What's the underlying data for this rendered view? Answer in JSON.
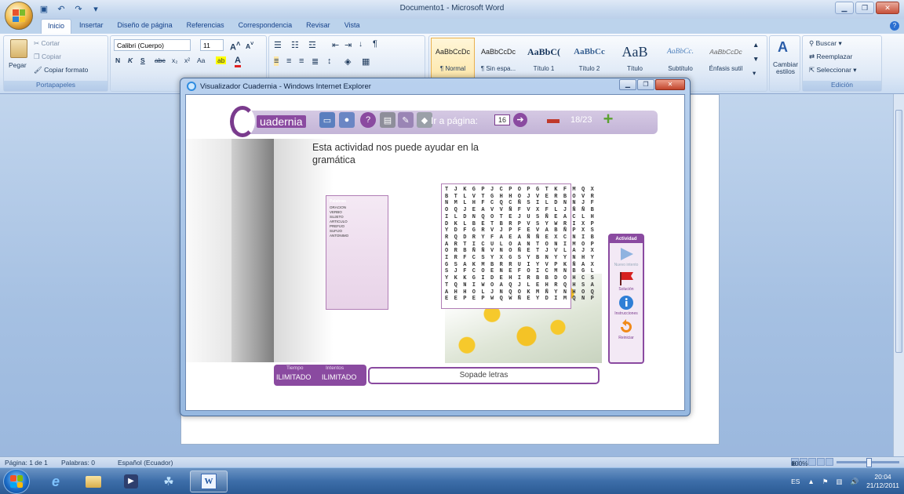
{
  "window": {
    "title": "Documento1 - Microsoft Word"
  },
  "tabs": [
    "Inicio",
    "Insertar",
    "Diseño de página",
    "Referencias",
    "Correspondencia",
    "Revisar",
    "Vista"
  ],
  "ribbon": {
    "clipboard": {
      "pegar": "Pegar",
      "cortar": "Cortar",
      "copiar": "Copiar",
      "copiar_formato": "Copiar formato",
      "label": "Portapapeles"
    },
    "font": {
      "name": "Calibri (Cuerpo)",
      "size": "11"
    },
    "styles": [
      {
        "preview": "AaBbCcDc",
        "name": "¶ Normal"
      },
      {
        "preview": "AaBbCcDc",
        "name": "¶ Sin espa..."
      },
      {
        "preview": "AaBbC(",
        "name": "Título 1"
      },
      {
        "preview": "AaBbCc",
        "name": "Título 2"
      },
      {
        "preview": "AaB",
        "name": "Título"
      },
      {
        "preview": "AaBbCc.",
        "name": "Subtítulo"
      },
      {
        "preview": "AaBbCcDc",
        "name": "Énfasis sutil"
      }
    ],
    "cambiar_estilos": "Cambiar estilos",
    "edicion": {
      "buscar": "Buscar",
      "reemplazar": "Reemplazar",
      "seleccionar": "Seleccionar",
      "label": "Edición"
    }
  },
  "ie": {
    "title": "Visualizador Cuadernia - Windows Internet Explorer",
    "cuadernia": {
      "logo_text": "uadernia",
      "goto_label": "Ir a página:",
      "goto_value": "16",
      "page_count": "18/23",
      "activity_text": "Esta actividad nos puede ayudar en la gramática",
      "words_title": "Palabras",
      "words": [
        "ORACION",
        "VERBO",
        "SUJETO",
        "ARTICULO",
        "PREFIJO",
        "SUFIJO",
        "ANTONIMO"
      ],
      "grid": [
        "T J K G P J C P O P G T K F M Q X",
        "B T L V T G H H O J V E R B O V R",
        "N M L H F C Q C Ñ S I L D N N J F",
        "O Q J E A V V Ñ F V X F L J Ñ Ñ B",
        "I L D N Q O T E J U S Ñ E A C L H",
        "D K L B E T B R P V S Y W R I X P",
        "Y D F G R V J P F E V A B Ñ P X S",
        "R Q D R Y F A E A Ñ Ñ E X C N I B",
        "A R T I C U L O A N T O N I M O P",
        "O R B Ñ Ñ V N O Ñ E T J V L A J X",
        "I R F C S Y X G S Y B N Y Y N H Y",
        "G S A K M B R R U I Y V P K Ñ A X",
        "S J F C O E N E F O I C M N B G L",
        "Y K K G I D E H I R B B D O H C S",
        "T Q N I W O A Q J L E H R Q H S A",
        "A H H O L J N Q O K M Ñ Y N H O Q",
        "E E P E P W Q W Ñ E Y D I M Q N P"
      ],
      "side_title": "Actividad",
      "side_items": [
        "Nuevo intento",
        "Solución",
        "Instrucciones",
        "Reiniciar"
      ],
      "tiempo_label": "Tiempo",
      "tiempo_value": "ILIMITADO",
      "intentos_label": "Intentos",
      "intentos_value": "ILIMITADO",
      "activity_title": "Sopade letras"
    }
  },
  "status": {
    "pagina": "Página: 1 de 1",
    "palabras": "Palabras: 0",
    "idioma": "Español (Ecuador)",
    "zoom": "100%"
  },
  "tray": {
    "lang": "ES",
    "time": "20:04",
    "date": "21/12/2011"
  },
  "colors": {
    "cuadernia_purple": "#8a4aa0",
    "word_blue": "#15428b"
  }
}
